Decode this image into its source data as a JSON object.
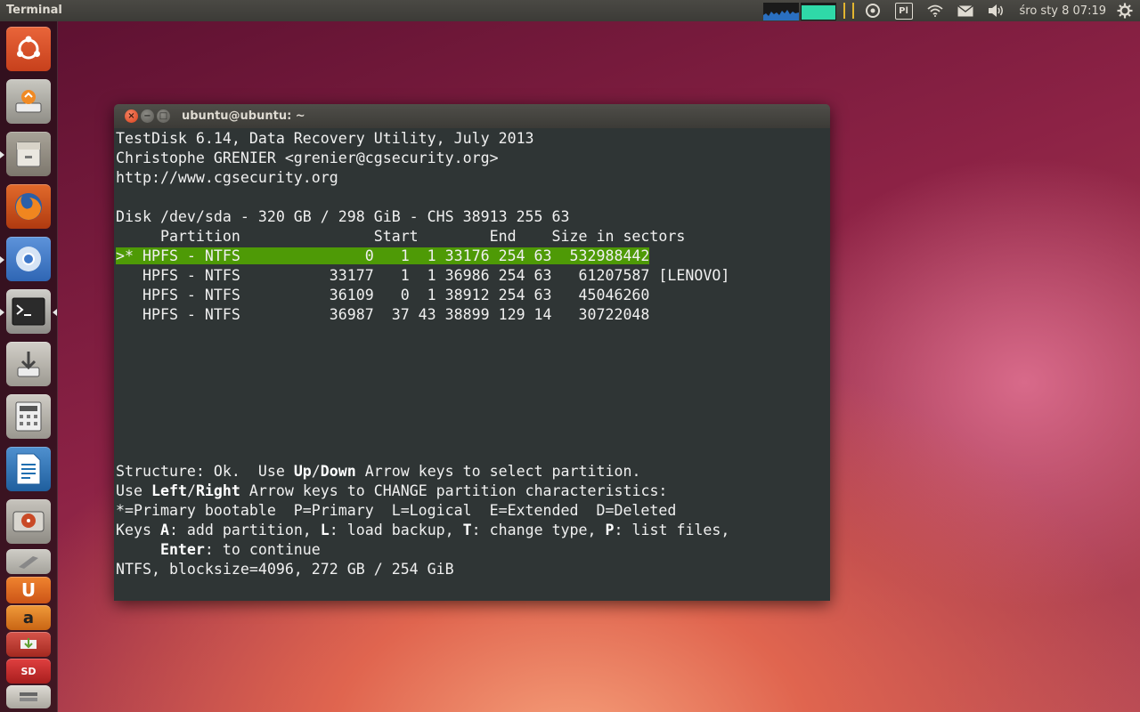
{
  "top_panel": {
    "app_title": "Terminal",
    "keyboard_layout": "Pl",
    "clock": "śro sty  8  07:19",
    "sysmon_cpu_fraction": 0.45,
    "sysmon_mem_fraction": 0.9
  },
  "launcher": {
    "items": [
      {
        "name": "dash-home",
        "icon": "ubuntu-logo-icon",
        "color": "#e2552a"
      },
      {
        "name": "software-updater",
        "icon": "updater-icon",
        "color": "#b9b9b0"
      },
      {
        "name": "files",
        "icon": "file-cabinet-icon",
        "color": "#9a948a"
      },
      {
        "name": "firefox",
        "icon": "firefox-icon",
        "color": "#d64b16"
      },
      {
        "name": "chromium",
        "icon": "chromium-icon",
        "color": "#3e78c9"
      },
      {
        "name": "terminal",
        "icon": "terminal-icon",
        "color": "#2b2b2b"
      },
      {
        "name": "install",
        "icon": "install-icon",
        "color": "#c9c6bf"
      },
      {
        "name": "calculator",
        "icon": "calculator-icon",
        "color": "#bdbab3"
      },
      {
        "name": "writer",
        "icon": "document-icon",
        "color": "#1f6fb1"
      },
      {
        "name": "disks",
        "icon": "disk-icon",
        "color": "#c94a26"
      }
    ],
    "stacked": [
      {
        "icon": "tools-icon",
        "color": "#b8b6ae"
      },
      {
        "icon": "ubuntu-one-icon",
        "color": "#e06a22"
      },
      {
        "icon": "amazon-icon",
        "color": "#e07b20"
      },
      {
        "icon": "startup-disk-icon",
        "color": "#c33b2b"
      },
      {
        "icon": "sd-card-icon",
        "color": "#cc2d2d"
      },
      {
        "icon": "stack-icon",
        "color": "#d8d5ce"
      }
    ],
    "sd_label": "SD"
  },
  "window": {
    "title": "ubuntu@ubuntu: ~",
    "close": "×",
    "minimize": "−",
    "maximize": "□"
  },
  "terminal": {
    "header": [
      "TestDisk 6.14, Data Recovery Utility, July 2013",
      "Christophe GRENIER <grenier@cgsecurity.org>",
      "http://www.cgsecurity.org",
      "",
      "Disk /dev/sda - 320 GB / 298 GiB - CHS 38913 255 63"
    ],
    "table_header": "     Partition               Start        End    Size in sectors",
    "rows": [
      {
        "text": ">* HPFS - NTFS              0   1  1 33176 254 63  532988442",
        "suffix": "",
        "selected": true
      },
      {
        "text": "   HPFS - NTFS          33177   1  1 36986 254 63   61207587",
        "suffix": " [LENOVO]",
        "selected": false
      },
      {
        "text": "   HPFS - NTFS          36109   0  1 38912 254 63   45046260",
        "suffix": "",
        "selected": false
      },
      {
        "text": "   HPFS - NTFS          36987  37 43 38899 129 14   30722048",
        "suffix": "",
        "selected": false
      }
    ],
    "footer": {
      "l1a": "Structure: Ok.  Use ",
      "l1b": "Up",
      "l1c": "/",
      "l1d": "Down",
      "l1e": " Arrow keys to select partition.",
      "l2a": "Use ",
      "l2b": "Left",
      "l2c": "/",
      "l2d": "Right",
      "l2e": " Arrow keys to CHANGE partition characteristics:",
      "l3": "*=Primary bootable  P=Primary  L=Logical  E=Extended  D=Deleted",
      "l4a": "Keys ",
      "l4b": "A",
      "l4c": ": add partition, ",
      "l4d": "L",
      "l4e": ": load backup, ",
      "l4f": "T",
      "l4g": ": change type, ",
      "l4h": "P",
      "l4i": ": list files,",
      "l5a": "     ",
      "l5b": "Enter",
      "l5c": ": to continue",
      "l6": "NTFS, blocksize=4096, 272 GB / 254 GiB"
    }
  }
}
